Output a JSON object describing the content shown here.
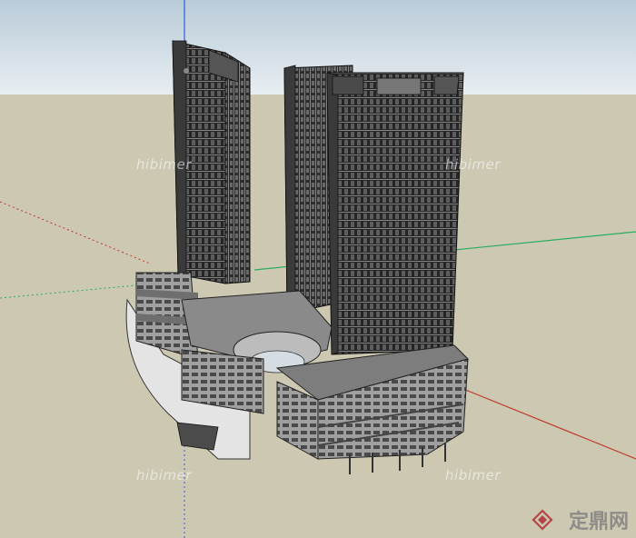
{
  "image": {
    "description_free": true,
    "colors": {
      "sky_top": "#b9cbd8",
      "sky_bottom": "#e8eef2",
      "ground": "#cdc8b2",
      "axis_red": "#c0392b",
      "axis_green": "#27ae60",
      "axis_blue": "#2e5bd8",
      "facade_dark": "#2b2b2b",
      "facade_grid": "#8c8c8c",
      "podium_wall": "#9a9a9a",
      "podium_roof": "#7d7d7d"
    }
  },
  "watermarks": [
    "hibimer",
    "hibimer",
    "hibimer",
    "hibimer"
  ],
  "brand": {
    "logo": "diamond-logo-icon",
    "text": "定鼎网"
  }
}
